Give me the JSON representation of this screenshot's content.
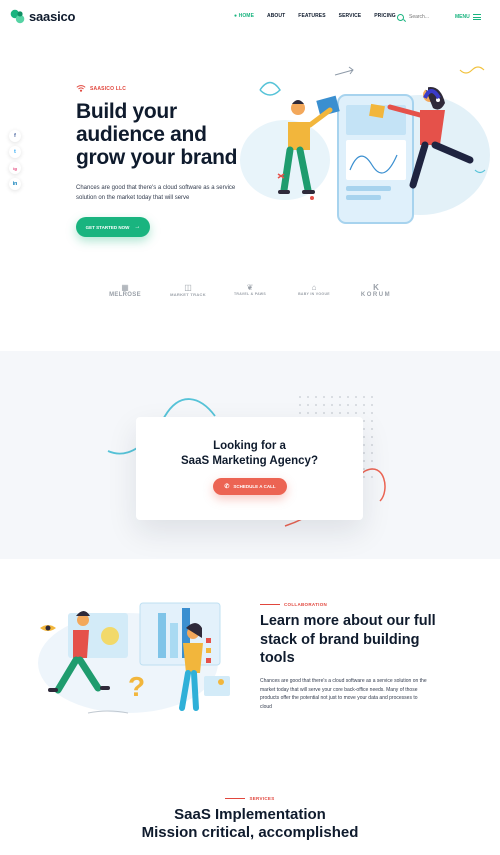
{
  "header": {
    "brand": "saasico",
    "nav": [
      "HOME",
      "ABOUT",
      "FEATURES",
      "SERVICE",
      "PRICING"
    ],
    "search_placeholder": "Search...",
    "menu_label": "MENU"
  },
  "social": [
    "f",
    "t",
    "ig",
    "in"
  ],
  "hero": {
    "tag": "SAASICO LLC",
    "title": "Build your audience and grow your brand",
    "description": "Chances are good that there's a cloud software as a service solution on the market today that will serve",
    "cta": "GET STARTED NOW"
  },
  "brands": [
    {
      "mark": "▦",
      "name": "MELROSE"
    },
    {
      "mark": "◫",
      "name": "MARKET TRACK"
    },
    {
      "mark": "❦",
      "name": "TRAVEL & PAWS"
    },
    {
      "mark": "⌂",
      "name": "BABY IN VOGUE"
    },
    {
      "mark": "K",
      "name": "KORUM"
    }
  ],
  "cta_card": {
    "title_line1": "Looking for a",
    "title_line2": "SaaS Marketing Agency?",
    "button": "SCHEDULE A CALL"
  },
  "about": {
    "tag": "COLLABORATION",
    "title": "Learn more about our full stack of brand building tools",
    "description": "Chances are good that there's a cloud software as a service solution on the market today that will serve your core back-office needs. Many of those products offer the potential not just to move your data and processes to cloud"
  },
  "services": {
    "tag": "SERVICES",
    "title_line1": "SaaS Implementation",
    "title_line2": "Mission critical, accomplished"
  },
  "colors": {
    "green": "#19b47f",
    "red": "#e1463d",
    "coral": "#ec6453",
    "navy": "#0f1b2d",
    "band": "#f5f7fa"
  }
}
